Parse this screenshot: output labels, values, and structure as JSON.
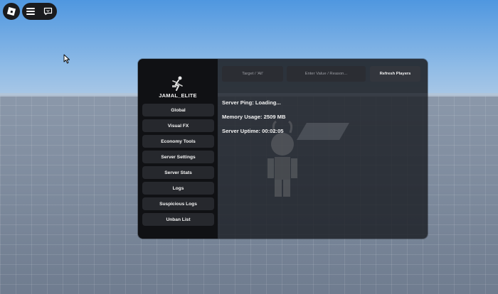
{
  "panel": {
    "username": "JAMAL_ELITE",
    "nav_items": [
      {
        "label": "Global"
      },
      {
        "label": "Visual FX"
      },
      {
        "label": "Economy Tools"
      },
      {
        "label": "Server Settings"
      },
      {
        "label": "Server Stats"
      },
      {
        "label": "Logs"
      },
      {
        "label": "Suspicious Logs"
      },
      {
        "label": "Unban List"
      }
    ],
    "toolbar": {
      "target_placeholder": "Target / 'All'",
      "value_placeholder": "Enter Value / Reason...",
      "refresh_label": "Refresh Players"
    },
    "stats": {
      "ping": "Server Ping: Loading...",
      "memory": "Memory Usage: 2509 MB",
      "uptime": "Server Uptime: 00:02:05"
    }
  },
  "icons": {
    "logo": "roblox-logo-icon",
    "menu": "hamburger-menu-icon",
    "chat": "chat-icon",
    "avatar": "user-avatar-icon",
    "cursor": "mouse-cursor-icon"
  },
  "colors": {
    "panel_bg": "#16181d",
    "sidebar_bg": "#101114",
    "button_bg": "#26282d",
    "text": "#f2f2f2"
  }
}
